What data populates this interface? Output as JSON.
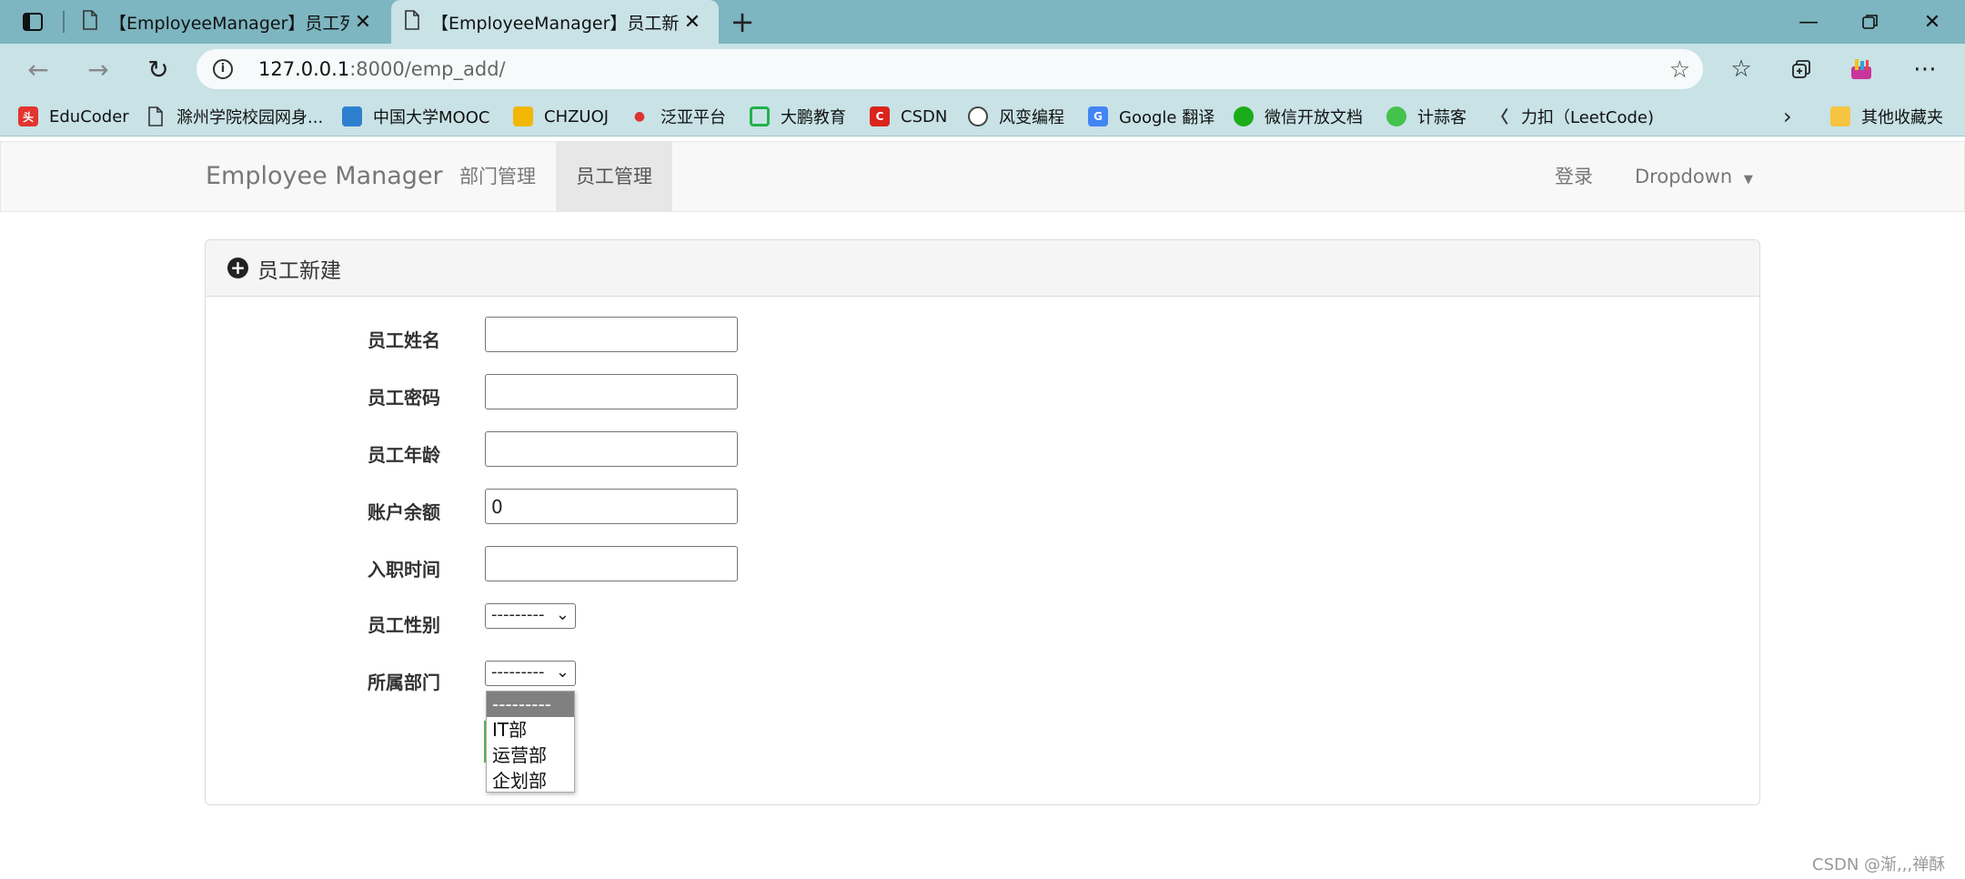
{
  "browser": {
    "tabs": [
      {
        "title": "【EmployeeManager】员工列表",
        "active": false
      },
      {
        "title": "【EmployeeManager】员工新建",
        "active": true
      }
    ],
    "url_host": "127.0.0.1",
    "url_rest": ":8000/emp_add/",
    "bookmarks": [
      {
        "label": "EduCoder",
        "icon": "toutiao-icon",
        "color": "#e3342f"
      },
      {
        "label": "滁州学院校园网身...",
        "icon": "page-icon",
        "color": "#ffffff"
      },
      {
        "label": "中国大学MOOC",
        "icon": "mooc-icon",
        "color": "#2f7fcf"
      },
      {
        "label": "CHZUOJ",
        "icon": "chzuoj-icon",
        "color": "#f2b705"
      },
      {
        "label": "泛亚平台",
        "icon": "fanya-icon",
        "color": "#d33"
      },
      {
        "label": "大鹏教育",
        "icon": "dapeng-icon",
        "color": "#22b14c"
      },
      {
        "label": "CSDN",
        "icon": "csdn-icon",
        "color": "#d9251c"
      },
      {
        "label": "风变编程",
        "icon": "fengbian-icon",
        "color": "#444444"
      },
      {
        "label": "Google 翻译",
        "icon": "google-translate-icon",
        "color": "#4285f4"
      },
      {
        "label": "微信开放文档",
        "icon": "wechat-icon",
        "color": "#1aad19"
      },
      {
        "label": "计蒜客",
        "icon": "jisuanke-icon",
        "color": "#43c34b"
      },
      {
        "label": "力扣（LeetCode)",
        "icon": "leetcode-icon",
        "color": "#e7a23b"
      }
    ],
    "other_bookmarks": "其他收藏夹"
  },
  "navbar": {
    "brand": "Employee Manager",
    "links": [
      "部门管理",
      "员工管理"
    ],
    "active_link": "员工管理",
    "login": "登录",
    "dropdown": "Dropdown"
  },
  "panel": {
    "title": "员工新建",
    "fields": [
      {
        "label": "员工姓名",
        "value": ""
      },
      {
        "label": "员工密码",
        "value": ""
      },
      {
        "label": "员工年龄",
        "value": ""
      },
      {
        "label": "账户余额",
        "value": "0"
      },
      {
        "label": "入职时间",
        "value": ""
      }
    ],
    "gender": {
      "label": "员工性别",
      "value": "---------"
    },
    "department": {
      "label": "所属部门",
      "value": "---------",
      "options": [
        "---------",
        "IT部",
        "运营部",
        "企划部"
      ]
    }
  },
  "watermark": "CSDN @渐,,,禅酥"
}
